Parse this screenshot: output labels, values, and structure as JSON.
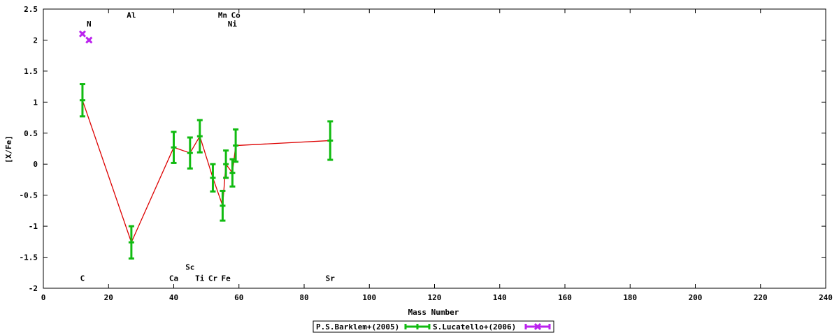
{
  "chart_data": {
    "type": "line",
    "title": "",
    "xlabel": "Mass Number",
    "ylabel": "[X/Fe]",
    "xlim": [
      0,
      240
    ],
    "ylim": [
      -2,
      2.5
    ],
    "xticks": [
      0,
      20,
      40,
      60,
      80,
      100,
      120,
      140,
      160,
      180,
      200,
      220,
      240
    ],
    "yticks": [
      -2,
      -1.5,
      -1,
      -0.5,
      0,
      0.5,
      1,
      1.5,
      2,
      2.5
    ],
    "xtick_labels": [
      "0",
      "20",
      "40",
      "60",
      "80",
      "100",
      "120",
      "140",
      "160",
      "180",
      "200",
      "220",
      "240"
    ],
    "ytick_labels": [
      "-2",
      "-1.5",
      "-1",
      "-0.5",
      "0",
      "0.5",
      "1",
      "1.5",
      "2",
      "2.5"
    ],
    "grid": false,
    "legend_position": "bottom-center",
    "series": [
      {
        "name": "P.S.Barklem+(2005)",
        "color": "#11bb11",
        "points": [
          {
            "x": 12,
            "y": 1.03,
            "err": 0.26
          },
          {
            "x": 27,
            "y": -1.26,
            "err": 0.26
          },
          {
            "x": 40,
            "y": 0.27,
            "err": 0.25
          },
          {
            "x": 45,
            "y": 0.18,
            "err": 0.25
          },
          {
            "x": 48,
            "y": 0.45,
            "err": 0.26
          },
          {
            "x": 52,
            "y": -0.22,
            "err": 0.22
          },
          {
            "x": 55,
            "y": -0.67,
            "err": 0.24
          },
          {
            "x": 56,
            "y": 0.0,
            "err": 0.22
          },
          {
            "x": 58,
            "y": -0.14,
            "err": 0.22
          },
          {
            "x": 59,
            "y": 0.3,
            "err": 0.26
          },
          {
            "x": 88,
            "y": 0.38,
            "err": 0.31
          }
        ]
      },
      {
        "name": "S.Lucatello+(2006)",
        "color": "#bb22ee",
        "points": [
          {
            "x": 12,
            "y": 2.1,
            "err": 0.02
          },
          {
            "x": 14,
            "y": 2.0,
            "err": 0.02
          }
        ]
      }
    ],
    "line_color": "#dd0000",
    "element_labels": [
      {
        "text": "C",
        "x": 12,
        "y": -1.88
      },
      {
        "text": "N",
        "x": 14,
        "y": 2.22
      },
      {
        "text": "Al",
        "x": 27,
        "y": 2.36
      },
      {
        "text": "Ca",
        "x": 40,
        "y": -1.88
      },
      {
        "text": "Sc",
        "x": 45,
        "y": -1.7
      },
      {
        "text": "Ti",
        "x": 48,
        "y": -1.88
      },
      {
        "text": "Cr",
        "x": 52,
        "y": -1.88
      },
      {
        "text": "Mn",
        "x": 55,
        "y": 2.36
      },
      {
        "text": "Fe",
        "x": 56,
        "y": -1.88
      },
      {
        "text": "Co",
        "x": 59,
        "y": 2.36
      },
      {
        "text": "Ni",
        "x": 58,
        "y": 2.22
      },
      {
        "text": "Sr",
        "x": 88,
        "y": -1.88
      }
    ]
  }
}
